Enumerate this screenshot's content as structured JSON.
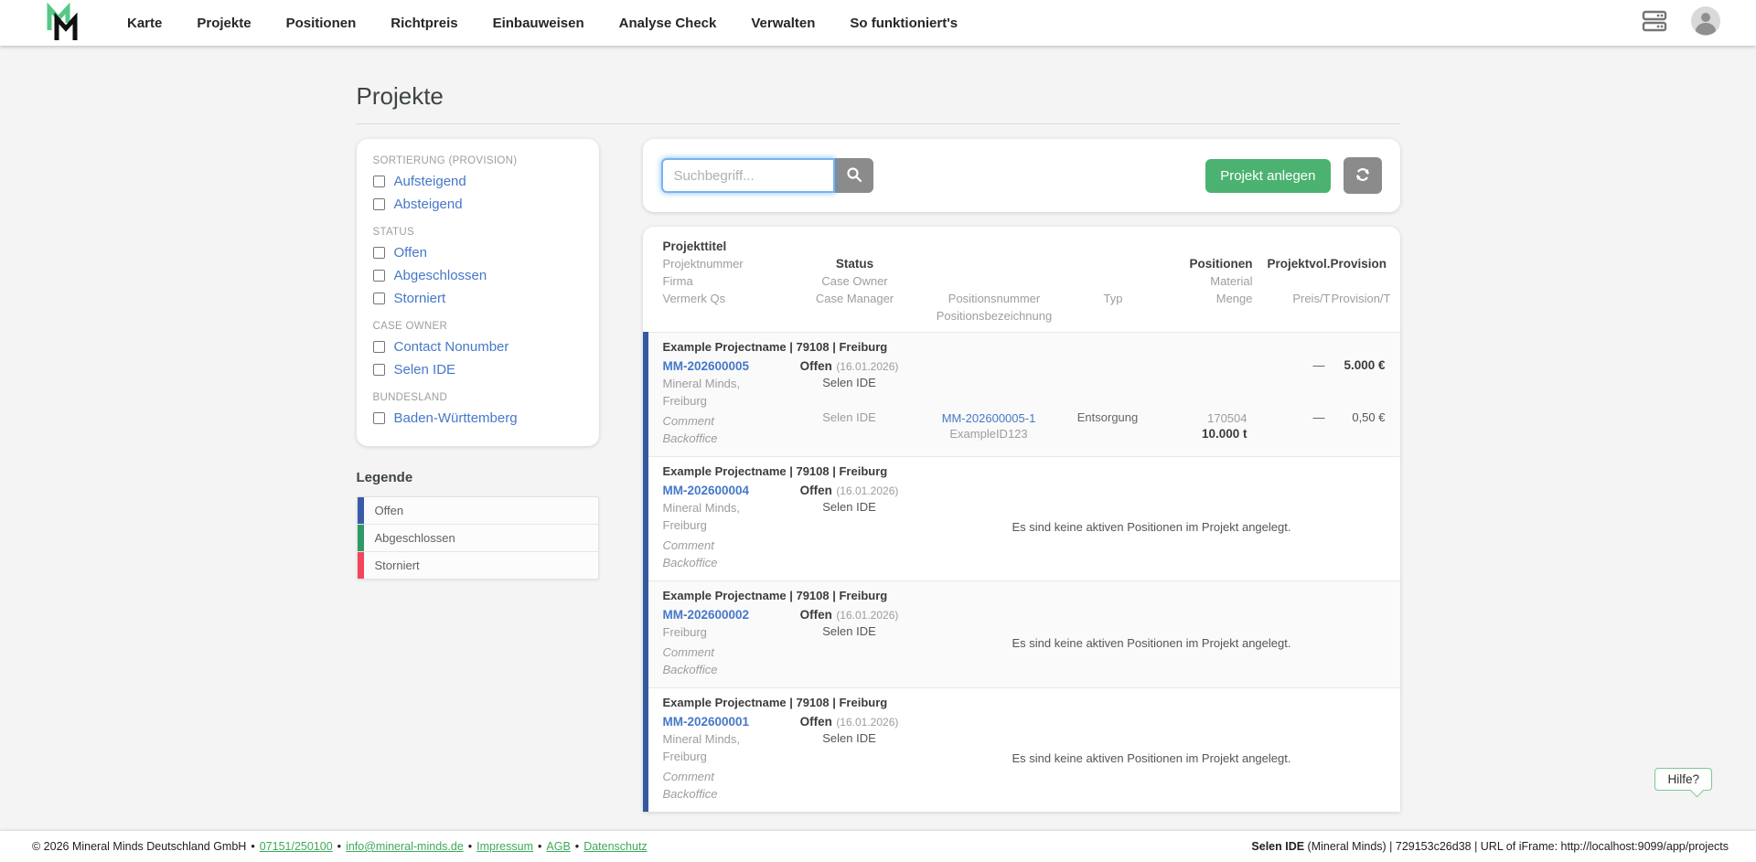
{
  "navbar": {
    "items": [
      "Karte",
      "Projekte",
      "Positionen",
      "Richtpreis",
      "Einbauweisen",
      "Analyse Check",
      "Verwalten",
      "So funktioniert's"
    ]
  },
  "page": {
    "title": "Projekte"
  },
  "filters": {
    "sections": [
      {
        "label": "SORTIERUNG (PROVISION)",
        "options": [
          "Aufsteigend",
          "Absteigend"
        ]
      },
      {
        "label": "STATUS",
        "options": [
          "Offen",
          "Abgeschlossen",
          "Storniert"
        ]
      },
      {
        "label": "CASE OWNER",
        "options": [
          "Contact Nonumber",
          "Selen IDE"
        ]
      },
      {
        "label": "BUNDESLAND",
        "options": [
          "Baden-Württemberg"
        ]
      }
    ]
  },
  "legend": {
    "title": "Legende",
    "items": [
      {
        "label": "Offen",
        "color": "#3a5ca8"
      },
      {
        "label": "Abgeschlossen",
        "color": "#2f9a68"
      },
      {
        "label": "Storniert",
        "color": "#f4455e"
      }
    ]
  },
  "toolbar": {
    "search_placeholder": "Suchbegriff...",
    "create_label": "Projekt anlegen"
  },
  "table": {
    "header": {
      "col1": [
        "Projekttitel",
        "Projektnummer",
        "Firma",
        "Vermerk Qs"
      ],
      "col2": [
        "Status",
        "Case Owner",
        "Case Manager"
      ],
      "col3": [
        "Positionsnummer",
        "Positionsbezeichnung"
      ],
      "col4": [
        "Typ"
      ],
      "col5": [
        "Positionen",
        "Material",
        "Menge"
      ],
      "col6": [
        "Projektvol.",
        "Preis/T"
      ],
      "col7": [
        "Provision",
        "Provision/T"
      ]
    },
    "empty_message": "Es sind keine aktiven Positionen im Projekt angelegt.",
    "rows": [
      {
        "title": "Example Projectname | 79108 | Freiburg",
        "number": "MM-202600005",
        "firma1": "Mineral Minds,",
        "firma2": "Freiburg",
        "vermerk1": "Comment",
        "vermerk2": "Backoffice",
        "status": "Offen",
        "status_date": "(16.01.2026)",
        "case_owner": "Selen IDE",
        "projektvol": "—",
        "provision": "5.000 €",
        "position": {
          "case_manager": "Selen IDE",
          "number": "MM-202600005-1",
          "name": "ExampleID123",
          "typ": "Entsorgung",
          "material": "170504",
          "menge": "10.000 t",
          "preis": "—",
          "provision": "0,50 €"
        }
      },
      {
        "title": "Example Projectname | 79108 | Freiburg",
        "number": "MM-202600004",
        "firma1": "Mineral Minds,",
        "firma2": "Freiburg",
        "vermerk1": "Comment",
        "vermerk2": "Backoffice",
        "status": "Offen",
        "status_date": "(16.01.2026)",
        "case_owner": "Selen IDE"
      },
      {
        "title": "Example Projectname | 79108 | Freiburg",
        "number": "MM-202600002",
        "firma1": "Freiburg",
        "vermerk1": "Comment",
        "vermerk2": "Backoffice",
        "status": "Offen",
        "status_date": "(16.01.2026)",
        "case_owner": "Selen IDE"
      },
      {
        "title": "Example Projectname | 79108 | Freiburg",
        "number": "MM-202600001",
        "firma1": "Mineral Minds,",
        "firma2": "Freiburg",
        "vermerk1": "Comment",
        "vermerk2": "Backoffice",
        "status": "Offen",
        "status_date": "(16.01.2026)",
        "case_owner": "Selen IDE"
      }
    ]
  },
  "footer": {
    "copyright": "© 2026 Mineral Minds Deutschland GmbH",
    "separator": "•",
    "phone": "07151/250100",
    "email": "info@mineral-minds.de",
    "links": [
      "Impressum",
      "AGB",
      "Datenschutz"
    ],
    "user": "Selen IDE",
    "session": " (Mineral Minds) | 729153c26d38 | URL of iFrame: http://localhost:9099/app/projects"
  },
  "help": {
    "label": "Hilfe?"
  },
  "colors": {
    "accent_green": "#4bb271",
    "link_blue": "#4678c8",
    "status_open": "#35599f",
    "status_done": "#2f9a68",
    "status_cancelled": "#f4455e",
    "footer_link": "#3fa95c",
    "logo_green": "#57c786"
  }
}
